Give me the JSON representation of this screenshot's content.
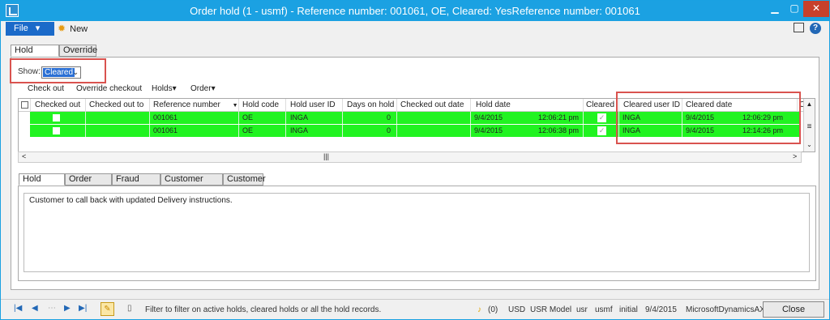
{
  "window": {
    "title": "Order hold (1 - usmf) - Reference number: 001061, OE, Cleared: YesReference number: 001061",
    "min_glyph": "▁",
    "max_glyph": "▢",
    "close_glyph": "✕"
  },
  "menu": {
    "file_label": "File",
    "file_arrow": "▾",
    "new_label": "New"
  },
  "top_tabs": [
    {
      "label": "Hold details"
    },
    {
      "label": "Override"
    }
  ],
  "filter": {
    "show_label": "Show:",
    "show_value": "Cleared",
    "arrow": "⌄"
  },
  "toolbar": {
    "check_out": "Check out",
    "override_checkout": "Override checkout",
    "holds": "Holds",
    "order": "Order",
    "dropdown_glyph": "▾"
  },
  "grid": {
    "columns": [
      "Checked out",
      "Checked out to",
      "Reference number",
      "Hold code",
      "Hold user ID",
      "Days on hold",
      "Checked out date",
      "Hold date",
      "Cleared",
      "Cleared user ID",
      "Cleared date",
      "C"
    ],
    "sort_glyph": "▼",
    "rows": [
      {
        "ref": "001061",
        "hold_code": "OE",
        "hold_user": "INGA",
        "days": "0",
        "hold_date": "9/4/2015",
        "hold_time": "12:06:21 pm",
        "cleared_user": "INGA",
        "cleared_date": "9/4/2015",
        "cleared_time": "12:06:29 pm"
      },
      {
        "ref": "001061",
        "hold_code": "OE",
        "hold_user": "INGA",
        "days": "0",
        "hold_date": "9/4/2015",
        "hold_time": "12:06:38 pm",
        "cleared_user": "INGA",
        "cleared_date": "9/4/2015",
        "cleared_time": "12:14:26 pm"
      }
    ]
  },
  "scrollbar": {
    "left": "<",
    "right": ">",
    "up": "▲",
    "down": "⌄",
    "thumb": "|||",
    "grip": "≡"
  },
  "bottom_tabs": [
    {
      "label": "Hold notes"
    },
    {
      "label": "Order notes"
    },
    {
      "label": "Fraud notes"
    },
    {
      "label": "Customer notes"
    },
    {
      "label": "Customer"
    }
  ],
  "notes": {
    "text": "Customer to call back with updated Delivery instructions."
  },
  "statusbar": {
    "nav_first": "|◀",
    "nav_prev": "◀",
    "nav_grid": "⋯",
    "nav_next": "▶",
    "nav_last": "▶|",
    "message": "Filter to filter on active holds, cleared holds or all the hold records.",
    "notifications": "(0)",
    "currency": "USD",
    "model": "USR Model",
    "layer": "usr",
    "company": "usmf",
    "config": "initial",
    "date": "9/4/2015",
    "product": "MicrosoftDynamicsAX",
    "close_label": "Close"
  },
  "colors": {
    "title_bar": "#1ba1e2",
    "row_highlight": "#21f321",
    "callout": "#d9534f",
    "file_button": "#1b6ac9"
  }
}
